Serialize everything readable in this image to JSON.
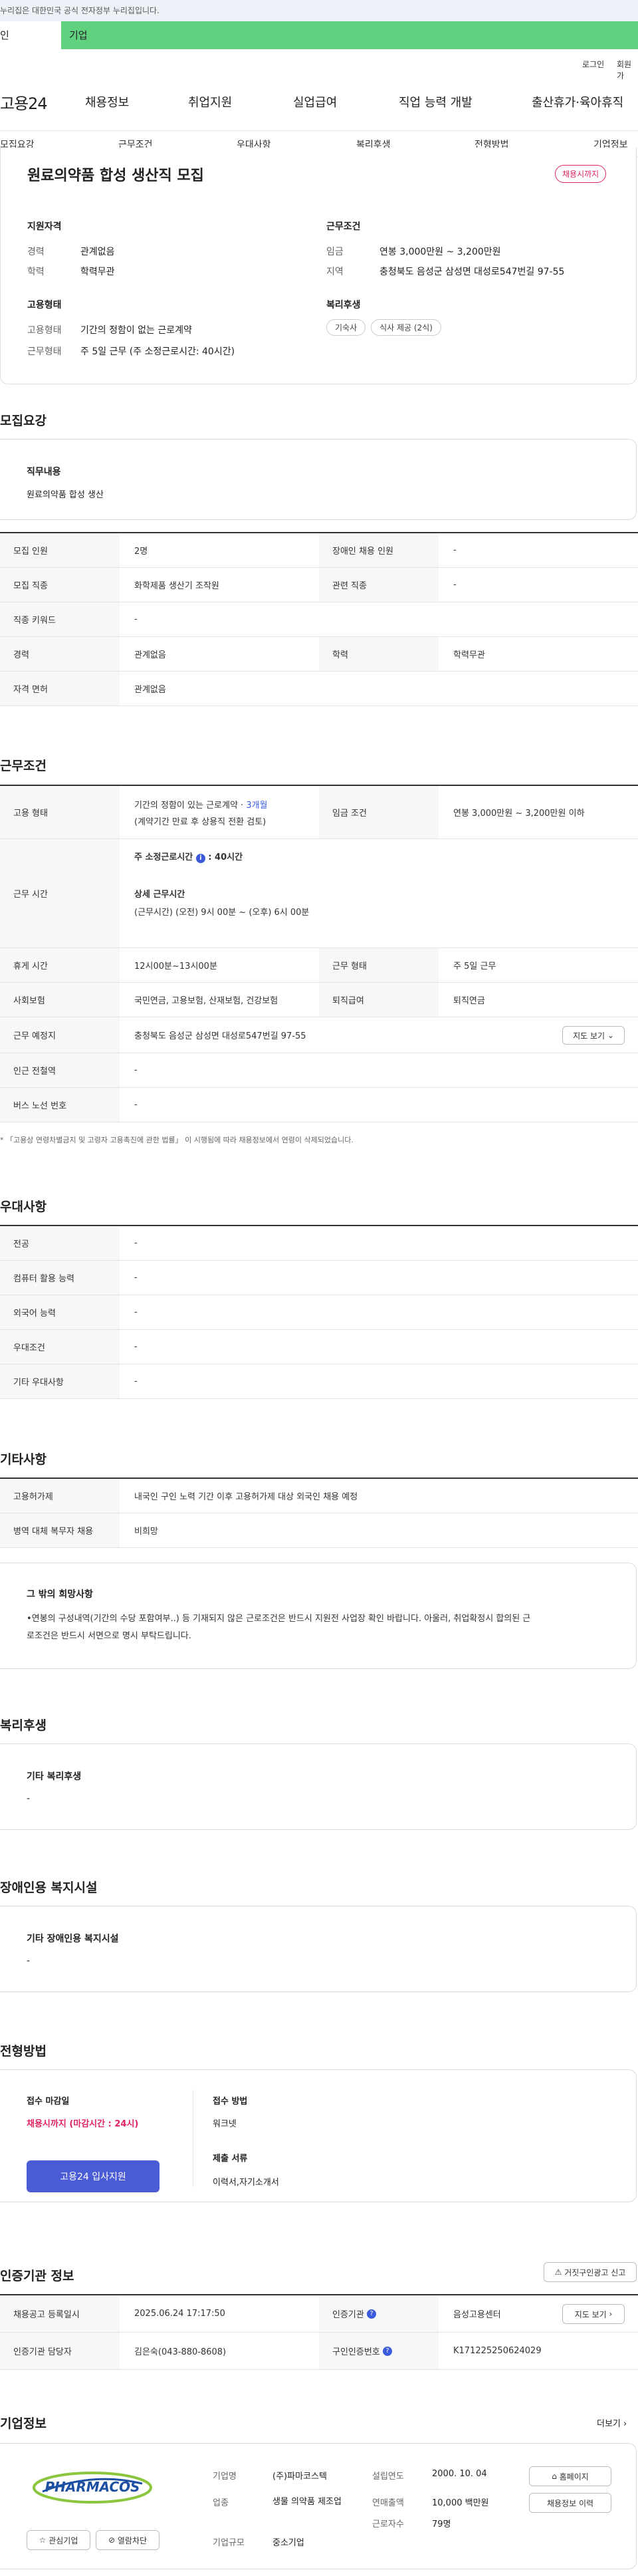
{
  "gov_banner": "누리집은 대한민국 공식 전자정부 누리집입니다.",
  "top_tabs": [
    "인",
    "기업"
  ],
  "util": [
    "로그인",
    "회원가"
  ],
  "gnb": {
    "logo": "고용24",
    "menu": [
      "채용정보",
      "취업지원",
      "실업급여",
      "직업 능력 개발",
      "출산휴가·육아휴직"
    ]
  },
  "lnb": [
    "모집요강",
    "근무조건",
    "우대사항",
    "복리후생",
    "전형방법",
    "기업정보"
  ],
  "summary": {
    "title": "원료의약품 합성 생산직 모집",
    "badge": "채용시까지",
    "sec1": {
      "title": "지원자격",
      "rows": [
        [
          "경력",
          "관계없음"
        ],
        [
          "학력",
          "학력무관"
        ]
      ]
    },
    "sec2": {
      "title": "근무조건",
      "rows": [
        [
          "임금",
          "연봉 3,000만원 ~ 3,200만원"
        ],
        [
          "지역",
          "충청북도 음성군 삼성면 대성로547번길 97-55"
        ]
      ]
    },
    "sec3": {
      "title": "고용형태",
      "rows": [
        [
          "고용형태",
          "기간의 정함이 없는 근로계약"
        ],
        [
          "근무형태",
          "주 5일 근무 (주 소정근로시간: 40시간)"
        ]
      ]
    },
    "sec4": {
      "title": "복리후생",
      "chips": [
        "기숙사",
        "식사 제공 (2식)"
      ]
    }
  },
  "recruit": {
    "title": "모집요강",
    "box_label": "직무내용",
    "box_value": "원료의약품 합성 생산",
    "rows": [
      {
        "h1": "모집 인원",
        "v1": "2명",
        "h2": "장애인 채용 인원",
        "v2": "-"
      },
      {
        "h1": "모집 직종",
        "v1": "화학제품 생산기 조작원",
        "h2": "관련 직종",
        "v2": "-"
      },
      {
        "h1": "직종 키워드",
        "v1": "-"
      },
      {
        "h1": "경력",
        "v1": "관계없음",
        "h2": "학력",
        "v2": "학력무관"
      },
      {
        "h1": "자격 면허",
        "v1": "관계없음"
      }
    ]
  },
  "work": {
    "title": "근무조건",
    "emp_h": "고용 형태",
    "emp_v1": "기간의 정함이 있는 근로계약 · ",
    "emp_v1b": "3개월",
    "emp_v2": "(계약기간 만료 후 상용직 전환 검토)",
    "wage_h": "임금 조건",
    "wage_v": "연봉 3,000만원 ~ 3,200만원 이하",
    "time_h": "근무 시간",
    "time_v1": "주 소정근로시간",
    "time_v1b": "40시간",
    "time_v2": "상세 근무시간",
    "time_v3": "(근무시간) (오전) 9시 00분 ~ (오후) 6시 00분",
    "rows": [
      {
        "h1": "휴게 시간",
        "v1": "12시00분~13시00분",
        "h2": "근무 형태",
        "v2": "주 5일 근무"
      },
      {
        "h1": "사회보험",
        "v1": "국민연금, 고용보험, 산재보험, 건강보험",
        "h2": "퇴직급여",
        "v2": "퇴직연금"
      },
      {
        "h1": "근무 예정지",
        "v1": "충청북도 음성군 삼성면 대성로547번길 97-55",
        "btn": "지도 보기"
      },
      {
        "h1": "인근 전철역",
        "v1": "-"
      },
      {
        "h1": "버스 노선 번호",
        "v1": "-"
      }
    ],
    "note": "* 「고용상 연령차별금지 및 고령자 고용촉진에 관한 법률」 이 시행됨에 따라 채용정보에서 연령이 삭제되었습니다."
  },
  "pref": {
    "title": "우대사항",
    "rows": [
      [
        "전공",
        "-"
      ],
      [
        "컴퓨터 활용 능력",
        "-"
      ],
      [
        "외국어 능력",
        "-"
      ],
      [
        "우대조건",
        "-"
      ],
      [
        "기타 우대사항",
        "-"
      ]
    ]
  },
  "etc": {
    "title": "기타사항",
    "rows": [
      [
        "고용허가제",
        "내국인 구인 노력 기간 이후 고용허가제 대상 외국인 채용 예정"
      ],
      [
        "병역 대체 복무자 채용",
        "비희망"
      ]
    ],
    "box_title": "그 밖의 희망사항",
    "box_text1": "•연봉의 구성내역(기간의 수당 포함여부..) 등 기재되지 않은 근로조건은 반드시 지원전 사업장 확인 바랍니다. 아울러, 취업확정시 합의된 근",
    "box_text2": "로조건은 반드시 서면으로 명시 부탁드립니다."
  },
  "welfare": {
    "title": "복리후생",
    "box_title": "기타 복리후생",
    "box_value": "-"
  },
  "disab": {
    "title": "장애인용 복지시설",
    "box_title": "기타 장애인용 복지시설",
    "box_value": "-"
  },
  "process": {
    "title": "전형방법",
    "deadline_label": "접수 마감일",
    "deadline_value": "채용시까지 (마감시간 : 24시)",
    "apply_btn": "고용24 입사지원",
    "method_label": "접수 방법",
    "method_value": "워크넷",
    "docs_label": "제출 서류",
    "docs_value": "이력서,자기소개서"
  },
  "cert": {
    "title": "인증기관 정보",
    "report_btn": "거짓구인광고 신고",
    "rows": [
      {
        "h1": "채용공고 등록일시",
        "v1": "2025.06.24 17:17:50",
        "h2": "인증기관",
        "v2": "음성고용센터",
        "btn": "지도 보기"
      },
      {
        "h1": "인증기관 담당자",
        "v1": "김은숙(043-880-8608)",
        "h2": "구인인증번호",
        "v2": "K171225250624029"
      }
    ]
  },
  "company": {
    "title": "기업정보",
    "more": "더보기",
    "logo_text": "PHARMACOS",
    "fav_btn": "관심기업",
    "block_btn": "열람차단",
    "c1": [
      [
        "기업명",
        "(주)파마코스텍"
      ],
      [
        "업종",
        "생물 의약품 제조업"
      ],
      [
        "기업규모",
        "중소기업"
      ]
    ],
    "c2": [
      [
        "설립연도",
        "2000. 10. 04"
      ],
      [
        "연매출액",
        "10,000 백만원"
      ],
      [
        "근로자수",
        "79명"
      ]
    ],
    "home_btn": "홈페이지",
    "list_btn": "채용정보 이력"
  },
  "colors": {
    "accent_green": "#60d17f",
    "apply_blue": "#4a5bd6",
    "red": "#e0245e"
  }
}
